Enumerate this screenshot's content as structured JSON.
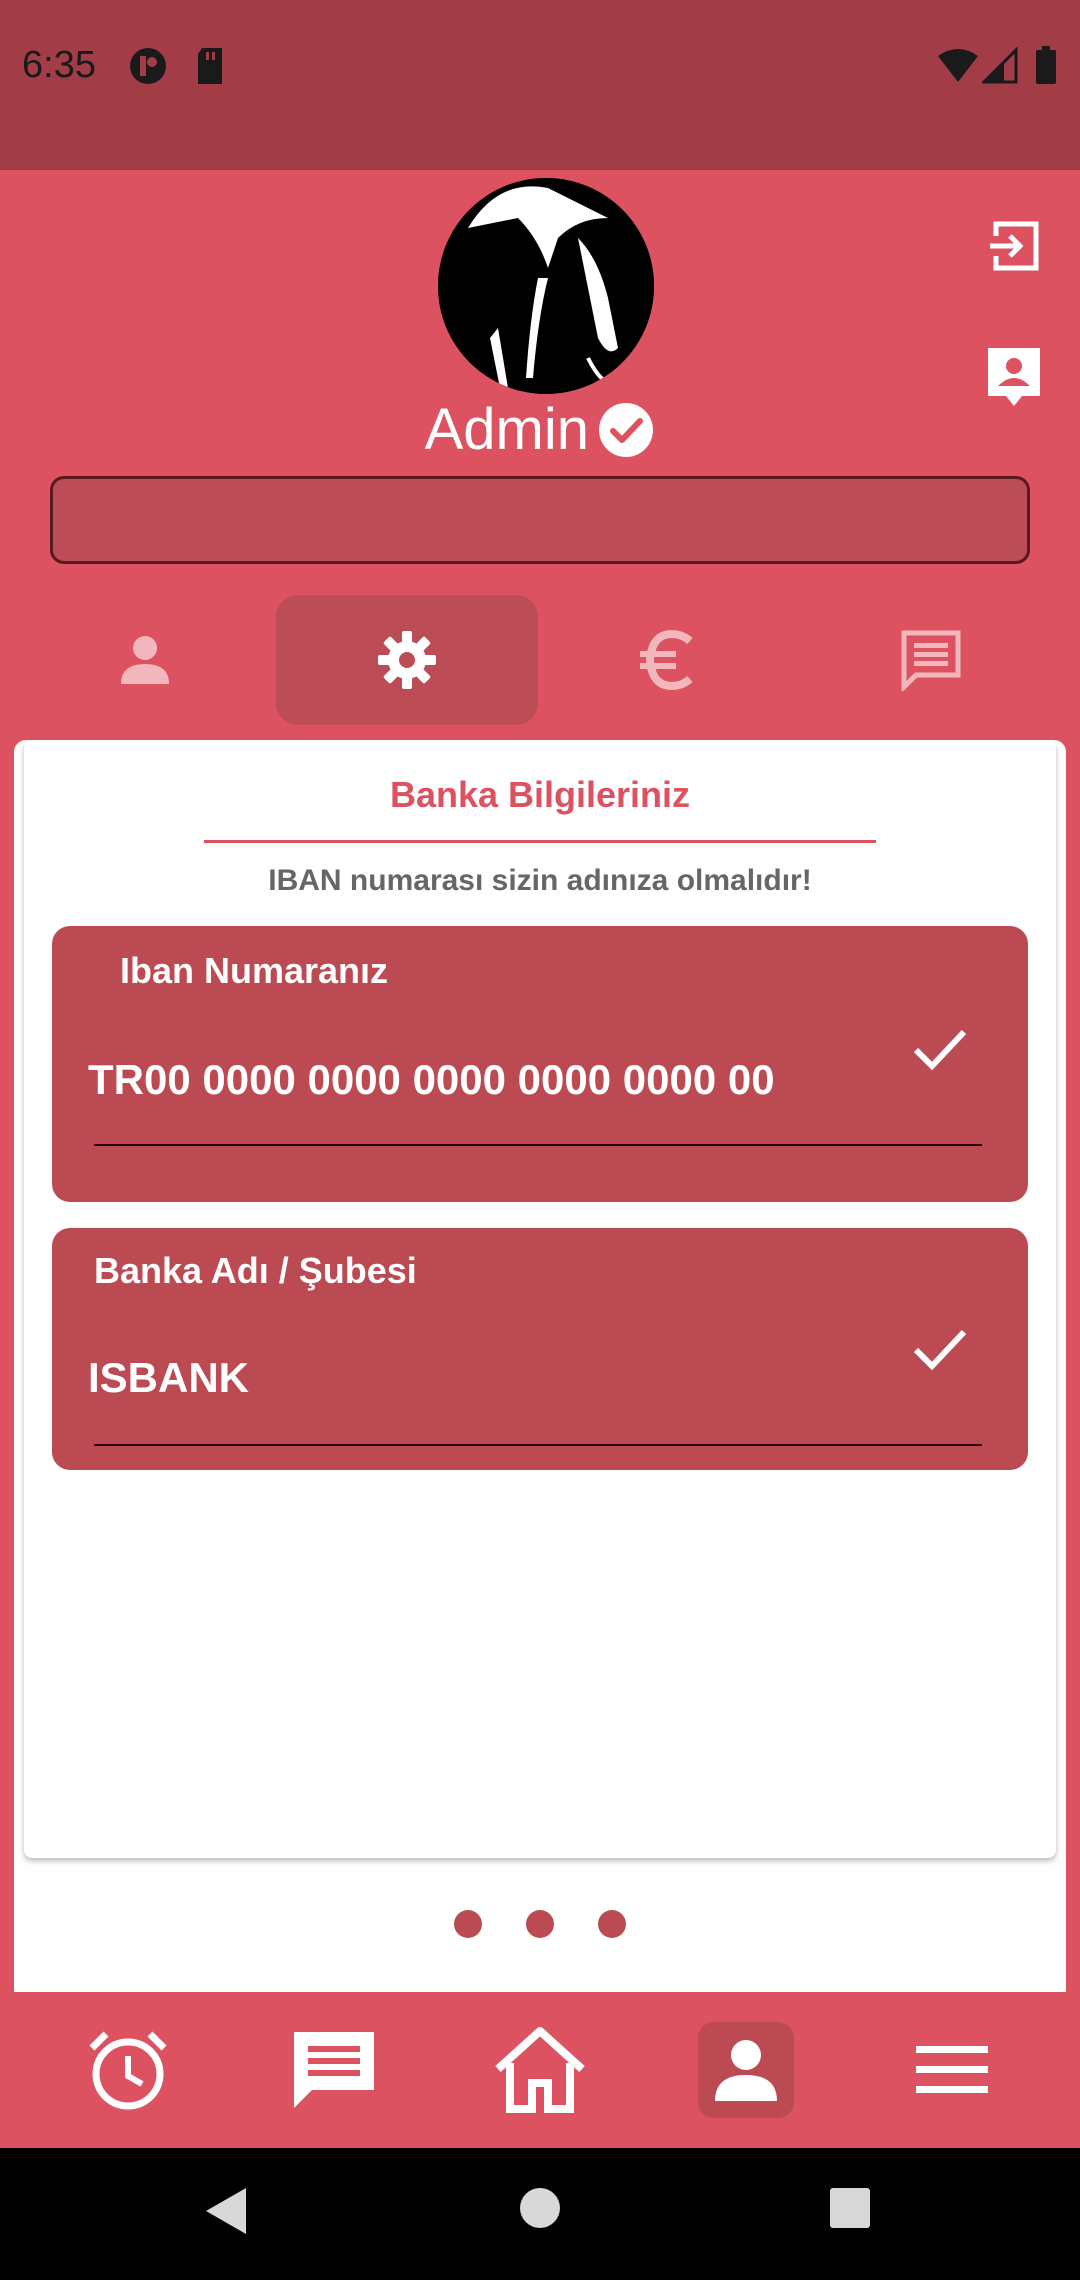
{
  "status_bar": {
    "time": "6:35"
  },
  "header": {
    "username": "Admin",
    "search": {
      "value": "",
      "placeholder": ""
    }
  },
  "tabs": [
    {
      "icon": "person-icon",
      "active": false
    },
    {
      "icon": "gear-icon",
      "active": true
    },
    {
      "icon": "euro-icon",
      "active": false
    },
    {
      "icon": "chat-icon",
      "active": false
    }
  ],
  "bank": {
    "title": "Banka Bilgileriniz",
    "subtitle": "IBAN numarası sizin adınıza olmalıdır!",
    "iban_label": "Iban Numaranız",
    "iban_value": "TR00 0000 0000 0000 0000 0000 00",
    "bank_label": "Banka Adı / Şubesi",
    "bank_value": "ISBANK"
  },
  "pager": {
    "pages": 3
  },
  "bottom_nav": [
    {
      "icon": "alarm-icon"
    },
    {
      "icon": "chat-icon"
    },
    {
      "icon": "home-icon"
    },
    {
      "icon": "person-icon",
      "active": true
    },
    {
      "icon": "menu-icon"
    }
  ],
  "colors": {
    "primary": "#dc5260",
    "primary_dark": "#a23d48",
    "field_bg": "#bb4a53",
    "white": "#ffffff"
  }
}
